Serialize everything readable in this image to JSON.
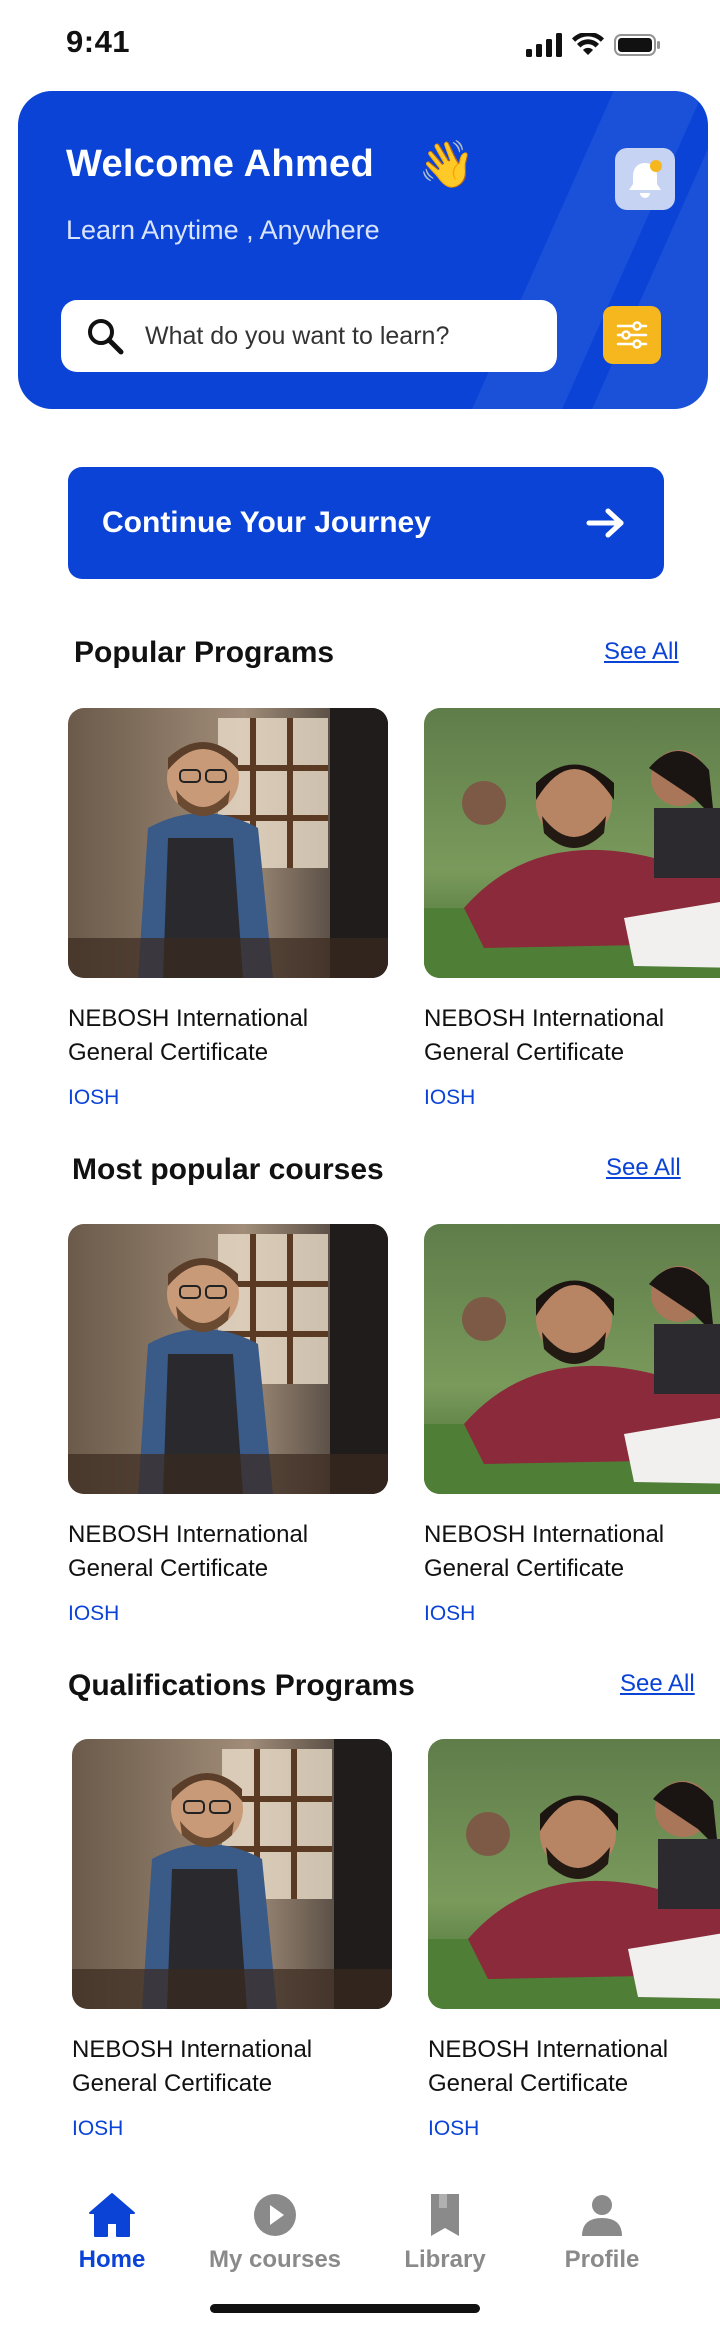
{
  "status": {
    "time": "9:41"
  },
  "header": {
    "welcome": "Welcome Ahmed",
    "wave_emoji": "👋",
    "tagline": "Learn Anytime , Anywhere",
    "search_placeholder": "What do you want to learn?",
    "accent": "#0a43d6",
    "filter_color": "#f5b71d"
  },
  "cta": {
    "label": "Continue Your Journey"
  },
  "sections": [
    {
      "title": "Popular Programs",
      "see_all": "See All",
      "cards": [
        {
          "title": "NEBOSH International General Certificate",
          "tag": "IOSH",
          "image": "craftsman-photo"
        },
        {
          "title": "NEBOSH International General Certificate",
          "tag": "IOSH",
          "image": "friends-on-grass-photo"
        }
      ]
    },
    {
      "title": "Most popular courses",
      "see_all": "See All",
      "cards": [
        {
          "title": "NEBOSH International General Certificate",
          "tag": "IOSH",
          "image": "craftsman-photo"
        },
        {
          "title": "NEBOSH International General Certificate",
          "tag": "IOSH",
          "image": "friends-on-grass-photo"
        }
      ]
    },
    {
      "title": "Qualifications Programs",
      "see_all": "See All",
      "cards": [
        {
          "title": "NEBOSH International General Certificate",
          "tag": "IOSH",
          "image": "craftsman-photo"
        },
        {
          "title": "NEBOSH International General Certificate",
          "tag": "IOSH",
          "image": "friends-on-grass-photo"
        }
      ]
    }
  ],
  "nav": {
    "items": [
      {
        "label": "Home",
        "icon": "home-icon",
        "active": true
      },
      {
        "label": "My courses",
        "icon": "play-icon",
        "active": false
      },
      {
        "label": "Library",
        "icon": "book-icon",
        "active": false
      },
      {
        "label": "Profile",
        "icon": "user-icon",
        "active": false
      }
    ],
    "active_color": "#0a43d6",
    "inactive_color": "#8a8a8a"
  }
}
